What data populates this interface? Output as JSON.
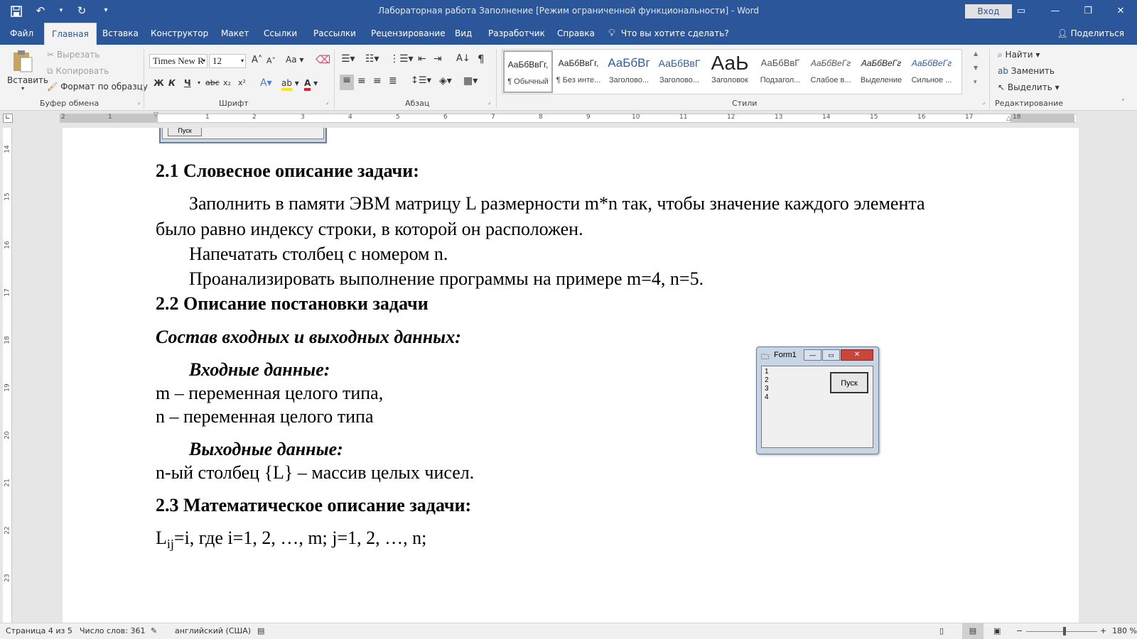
{
  "window": {
    "title": "Лабораторная работа Заполнение [Режим ограниченной функциональности]  -  Word",
    "signin": "Вход"
  },
  "tabs": [
    "Файл",
    "Главная",
    "Вставка",
    "Конструктор",
    "Макет",
    "Ссылки",
    "Рассылки",
    "Рецензирование",
    "Вид",
    "Разработчик",
    "Справка"
  ],
  "tellme": "Что вы хотите сделать?",
  "share": "Поделиться",
  "clipboard": {
    "paste": "Вставить",
    "cut": "Вырезать",
    "copy": "Копировать",
    "format_painter": "Формат по образцу",
    "label": "Буфер обмена"
  },
  "font": {
    "name": "Times New R",
    "size": "12",
    "label": "Шрифт",
    "bold": "Ж",
    "italic": "К",
    "underline": "Ч",
    "strike": "abc",
    "sub": "x₂",
    "sup": "x²",
    "case": "Aa"
  },
  "paragraph": {
    "label": "Абзац"
  },
  "styles": {
    "label": "Стили",
    "items": [
      {
        "sample": "АаБбВвГг,",
        "name": "¶ Обычный"
      },
      {
        "sample": "АаБбВвГг,",
        "name": "¶ Без инте..."
      },
      {
        "sample": "АаБбВг",
        "name": "Заголово..."
      },
      {
        "sample": "АаБбВвГ",
        "name": "Заголово..."
      },
      {
        "sample": "АаЬ",
        "name": "Заголовок"
      },
      {
        "sample": "АаБбВвГ",
        "name": "Подзагол..."
      },
      {
        "sample": "АаБбВеГг",
        "name": "Слабое в..."
      },
      {
        "sample": "АаБбВеГг",
        "name": "Выделение"
      },
      {
        "sample": "АаБбВеГг",
        "name": "Сильное ..."
      }
    ]
  },
  "editing": {
    "find": "Найти",
    "replace": "Заменить",
    "select": "Выделить",
    "label": "Редактирование"
  },
  "hruler": [
    "2",
    "1",
    "1",
    "2",
    "3",
    "4",
    "5",
    "6",
    "7",
    "8",
    "9",
    "10",
    "11",
    "12",
    "13",
    "14",
    "15",
    "16",
    "17",
    "18"
  ],
  "vruler": [
    "14",
    "15",
    "16",
    "17",
    "18",
    "19",
    "20",
    "21",
    "22",
    "23"
  ],
  "doc": {
    "top_button": "Пуск",
    "h21": "2.1 Словесное описание задачи:",
    "p1a": "Заполнить в памяти ЭВМ матрицу L размерности m*n так, чтобы значение каждого элемента",
    "p1b": "было равно индексу строки, в которой он расположен.",
    "p2": "Напечатать столбец с номером n.",
    "p3": "Проанализировать выполнение программы на примере m=4, n=5.",
    "h22": "2.2  Описание постановки задачи",
    "io_heading": "Состав входных и выходных данных:",
    "input_heading": "Входные данные:",
    "input_m": "m – переменная целого типа,",
    "input_n": "n – переменная целого типа",
    "output_heading": "Выходные данные:",
    "output_line": "n-ый столбец {L} – массив целых чисел.",
    "h23": "2.3 Математическое описание задачи:",
    "formula_L": "L",
    "formula_sub": "ij",
    "formula_rest": "=i, где i=1, 2, …, m; j=1, 2, …, n;"
  },
  "form1": {
    "title": "Form1",
    "lines": [
      "1",
      "2",
      "3",
      "4"
    ],
    "button": "Пуск"
  },
  "status": {
    "page": "Страница 4 из 5",
    "words": "Число слов: 361",
    "language": "английский (США)",
    "zoom": "180 %"
  }
}
